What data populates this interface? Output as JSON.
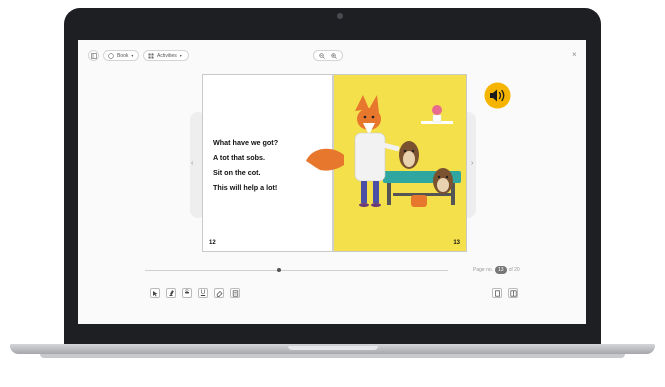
{
  "toolbar": {
    "book_label": "Book",
    "activities_label": "Activities",
    "close": "×"
  },
  "book": {
    "left_page": {
      "lines": [
        "What have we got?",
        "A tot that sobs.",
        "Sit on the cot.",
        "This will help a lot!"
      ],
      "number": "12"
    },
    "right_page": {
      "number": "13"
    }
  },
  "navigation": {
    "prev": "‹",
    "next": "›",
    "page_label": "Page no.",
    "current_page": "13",
    "total_label": "of 20",
    "progress": 0.44
  },
  "colors": {
    "page_right_bg": "#f4e04a",
    "audio_bg": "#f5b400",
    "laptop": "#1e1f22"
  },
  "icons": [
    "book-icon",
    "grid-icon",
    "zoom-out-icon",
    "zoom-in-icon",
    "speaker-icon",
    "close-icon"
  ]
}
